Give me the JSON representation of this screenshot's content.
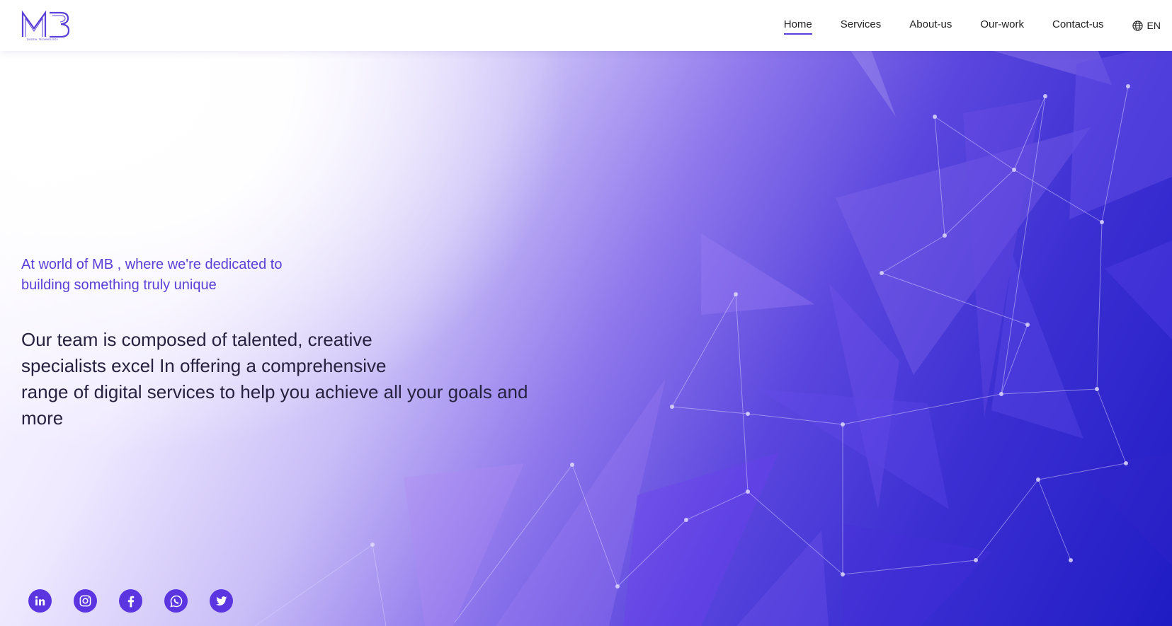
{
  "brand": {
    "logo_letters": "MB",
    "logo_subtext": "DIGITAL TECHNOLOGY",
    "accent_color": "#5b35e0"
  },
  "nav": {
    "items": [
      {
        "label": "Home",
        "active": true
      },
      {
        "label": "Services",
        "active": false
      },
      {
        "label": "About-us",
        "active": false
      },
      {
        "label": "Our-work",
        "active": false
      },
      {
        "label": "Contact-us",
        "active": false
      }
    ],
    "language": {
      "label": "EN",
      "icon": "globe-icon"
    }
  },
  "hero": {
    "tagline_line1": "At world of MB , where we're dedicated to",
    "tagline_line2": "building something truly unique",
    "lead_line1": "Our team is composed of talented, creative",
    "lead_line2": "specialists excel In offering a comprehensive",
    "lead_line3": "range of digital services to help you achieve all your goals and more"
  },
  "socials": [
    {
      "name": "linkedin",
      "icon": "linkedin-icon"
    },
    {
      "name": "instagram",
      "icon": "instagram-icon"
    },
    {
      "name": "facebook",
      "icon": "facebook-icon"
    },
    {
      "name": "whatsapp",
      "icon": "whatsapp-icon"
    },
    {
      "name": "twitter",
      "icon": "twitter-icon"
    }
  ]
}
